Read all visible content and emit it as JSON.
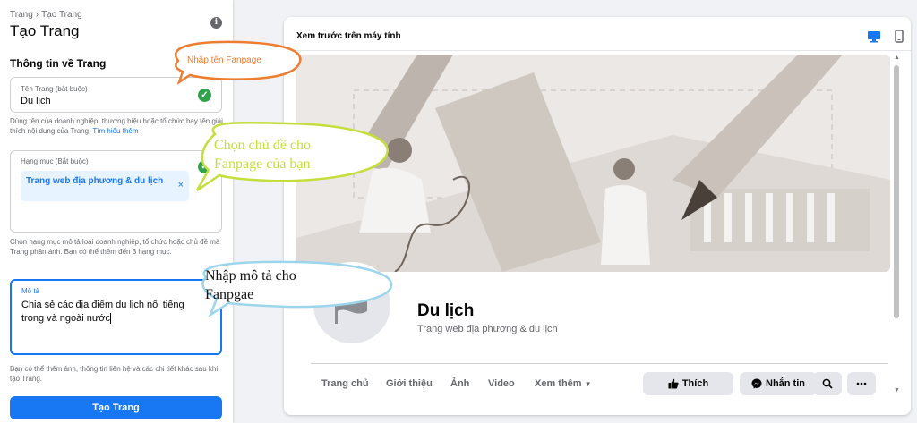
{
  "left_panel": {
    "breadcrumb": {
      "parent": "Trang",
      "separator": "›",
      "current": "Tạo Trang"
    },
    "title": "Tạo Trang",
    "section_title": "Thông tin về Trang",
    "name_field": {
      "label": "Tên Trang (bắt buộc)",
      "value": "Du lịch"
    },
    "name_help": "Dùng tên của doanh nghiệp, thương hiệu hoặc tổ chức hay tên giải thích nội dung của Trang.",
    "learn_more": "Tìm hiểu thêm",
    "category_field": {
      "label": "Hạng mục (Bắt buộc)",
      "chip": "Trang web địa phương & du lịch",
      "chip_remove": "×"
    },
    "category_help": "Chọn hạng mục mô tả loại doanh nghiệp, tổ chức hoặc chủ đề mà Trang phản ánh. Bạn có thể thêm đến 3 hạng mục.",
    "description_field": {
      "label": "Mô tả",
      "value": "Chia sẻ các địa điểm du lịch nổi tiếng trong và ngoài nước"
    },
    "bottom_help": "Bạn có thể thêm ảnh, thông tin liên hệ và các chi tiết khác sau khi tạo Trang.",
    "create_button": "Tạo Trang"
  },
  "annotations": {
    "name_note": "Nhập tên Fanpage",
    "category_note": "Chọn chủ đề cho Fanpage của bạn",
    "description_note": "Nhập mô tả cho Fanpgae"
  },
  "preview": {
    "title": "Xem trước trên máy tính",
    "page_name": "Du lịch",
    "page_category": "Trang web địa phương & du lịch",
    "tabs": [
      "Trang chủ",
      "Giới thiệu",
      "Ảnh",
      "Video",
      "Xem thêm"
    ],
    "actions": {
      "like": "Thích",
      "message": "Nhắn tin"
    }
  },
  "colors": {
    "accent": "#1877f2",
    "success": "#31a24c",
    "annotation_orange": "#ed7d31",
    "annotation_green": "#c5de3c",
    "annotation_blue": "#9dd6ec"
  },
  "icons": [
    "info-icon",
    "check-icon",
    "close-icon",
    "desktop-icon",
    "mobile-icon",
    "flag-icon",
    "thumbs-up-icon",
    "messenger-icon",
    "search-icon",
    "more-icon",
    "caret-down-icon"
  ]
}
